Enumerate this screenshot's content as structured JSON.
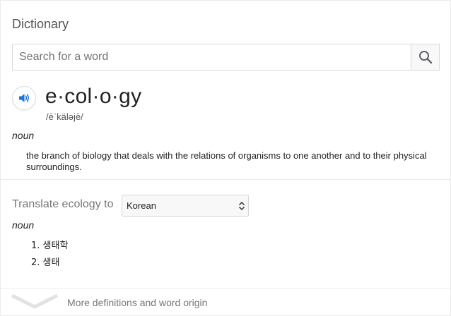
{
  "panel": {
    "title": "Dictionary"
  },
  "search": {
    "placeholder": "Search for a word",
    "button_icon": "search-icon"
  },
  "entry": {
    "audio_icon": "speaker-icon",
    "headword": "e·col·o·gy",
    "pronunciation": "/ēˈkäləjē/",
    "part_of_speech": "noun",
    "definition": "the branch of biology that deals with the relations of organisms to one another and to their physical surroundings."
  },
  "translate": {
    "label": "Translate ecology to",
    "selected_language": "Korean",
    "part_of_speech": "noun",
    "items": [
      {
        "number": "1.",
        "text": "생태학"
      },
      {
        "number": "2.",
        "text": "생태"
      }
    ]
  },
  "footer": {
    "more_label": "More definitions and word origin",
    "expand_icon": "chevron-down-icon"
  },
  "colors": {
    "accent_blue": "#1a73e8",
    "border": "#d9d9d9",
    "muted_text": "#777777"
  }
}
